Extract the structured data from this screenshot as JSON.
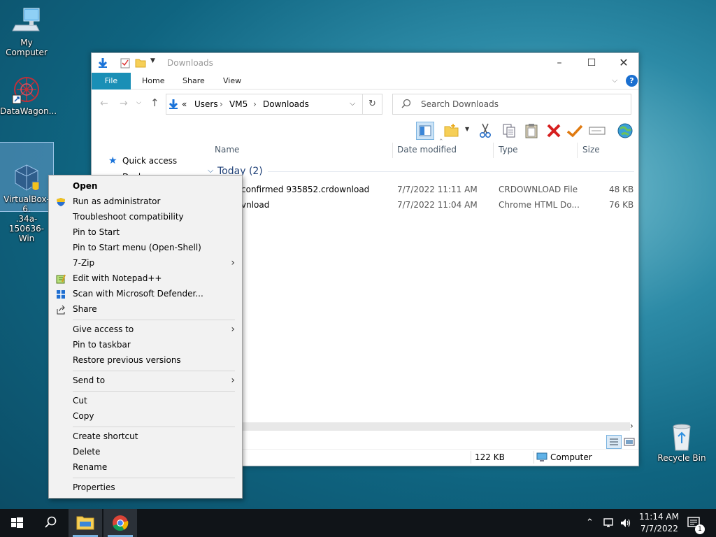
{
  "desktop": {
    "icons": [
      {
        "label": "My Computer"
      },
      {
        "label": "DataWagon..."
      },
      {
        "label": "VirtualBox-6.\n.34a-150636-\nWin"
      },
      {
        "label": "Recycle Bin"
      }
    ]
  },
  "explorer": {
    "title": "Downloads",
    "ribbon_tabs": [
      "File",
      "Home",
      "Share",
      "View"
    ],
    "breadcrumb": [
      "«",
      "Users",
      "VM5",
      "Downloads"
    ],
    "search_placeholder": "Search Downloads",
    "sidebar": {
      "quick_access": "Quick access",
      "desktop_partial": "Deskt"
    },
    "columns": {
      "name": "Name",
      "date": "Date modified",
      "type": "Type",
      "size": "Size"
    },
    "group": "Today (2)",
    "files": [
      {
        "name": "confirmed 935852.crdownload",
        "date": "7/7/2022 11:11 AM",
        "type": "CRDOWNLOAD File",
        "size": "48 KB"
      },
      {
        "name": "vnload",
        "date": "7/7/2022 11:04 AM",
        "type": "Chrome HTML Do...",
        "size": "76 KB"
      }
    ],
    "status": {
      "size": "122 KB",
      "location": "Computer"
    }
  },
  "context_menu": {
    "items": [
      {
        "label": "Open"
      },
      {
        "label": "Run as administrator"
      },
      {
        "label": "Troubleshoot compatibility"
      },
      {
        "label": "Pin to Start"
      },
      {
        "label": "Pin to Start menu (Open-Shell)"
      },
      {
        "label": "7-Zip"
      },
      {
        "label": "Edit with Notepad++"
      },
      {
        "label": "Scan with Microsoft Defender..."
      },
      {
        "label": "Share"
      },
      {
        "label": "Give access to"
      },
      {
        "label": "Pin to taskbar"
      },
      {
        "label": "Restore previous versions"
      },
      {
        "label": "Send to"
      },
      {
        "label": "Cut"
      },
      {
        "label": "Copy"
      },
      {
        "label": "Create shortcut"
      },
      {
        "label": "Delete"
      },
      {
        "label": "Rename"
      },
      {
        "label": "Properties"
      }
    ]
  },
  "taskbar": {
    "time": "11:14 AM",
    "date": "7/7/2022",
    "notifications": "1"
  },
  "colors": {
    "accent": "#1a8fb6",
    "taskbar": "#101418"
  }
}
